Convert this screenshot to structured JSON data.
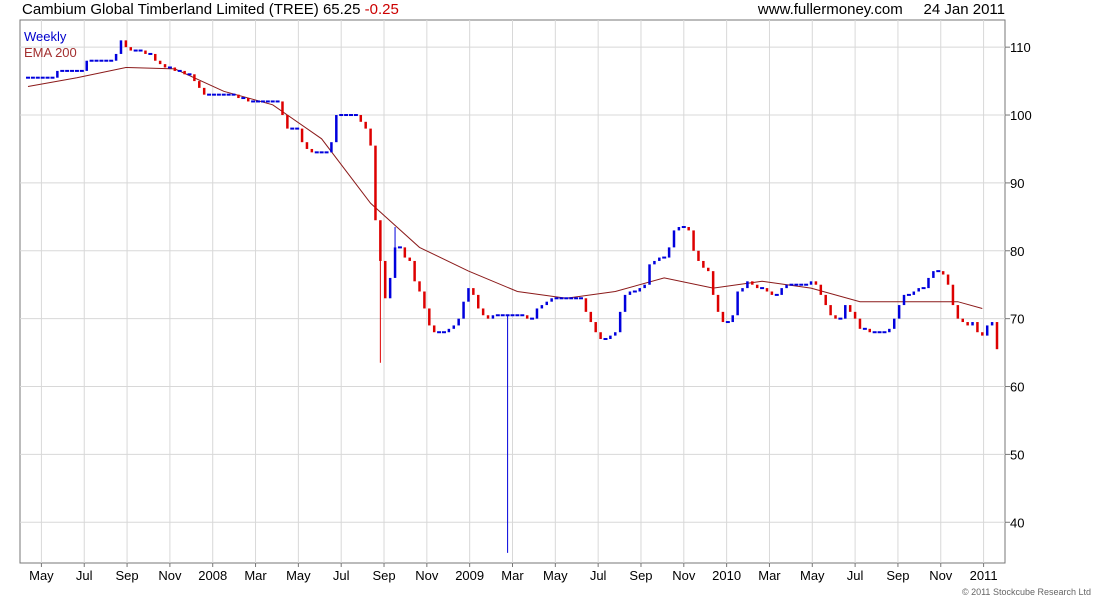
{
  "header": {
    "company": "Cambium Global Timberland Limited (TREE)",
    "last_price": "65.25",
    "change": "-0.25",
    "source_site": "www.fullermoney.com",
    "date": "24 Jan 2011"
  },
  "footer": {
    "copyright": "© 2011 Stockcube Research Ltd"
  },
  "colors": {
    "up": "#0000dd",
    "down": "#dd0000",
    "ema": "#8b1a1a",
    "grid": "#d8d8d8"
  },
  "chart_data": {
    "type": "line",
    "title": "Cambium Global Timberland Limited (TREE)",
    "timeframe": "Weekly",
    "ylim": [
      34,
      114
    ],
    "yticks": [
      40,
      50,
      60,
      70,
      80,
      90,
      100,
      110
    ],
    "x_labels": [
      "May",
      "Jul",
      "Sep",
      "Nov",
      "2008",
      "Mar",
      "May",
      "Jul",
      "Sep",
      "Nov",
      "2009",
      "Mar",
      "May",
      "Jul",
      "Sep",
      "Nov",
      "2010",
      "Mar",
      "May",
      "Jul",
      "Sep",
      "Nov",
      "2011"
    ],
    "legend": [
      "Weekly",
      "EMA 200"
    ],
    "legend_position": "top-left",
    "grid": true,
    "series": [
      {
        "name": "Weekly",
        "kind": "ohlc-bars",
        "x": [
          0,
          1,
          2,
          3,
          4,
          5,
          6,
          7,
          8,
          9,
          10,
          11,
          12,
          13,
          14,
          15,
          16,
          17,
          18,
          19,
          20,
          21,
          22,
          23,
          24,
          25,
          26,
          27,
          28,
          29,
          30,
          31,
          32,
          33,
          34,
          35,
          36,
          37,
          38,
          39,
          40,
          41,
          42,
          43,
          44,
          45,
          46,
          47,
          48,
          49,
          50,
          51,
          52,
          53,
          54,
          55,
          56,
          57,
          58,
          59,
          60,
          61,
          62,
          63,
          64,
          65,
          66,
          67,
          68,
          69,
          70,
          71,
          72,
          73,
          74,
          75,
          76,
          77,
          78,
          79,
          80,
          81,
          82,
          83,
          84,
          85,
          86,
          87,
          88,
          89,
          90,
          91,
          92,
          93,
          94,
          95,
          96,
          97,
          98,
          99,
          100,
          101,
          102,
          103,
          104,
          105,
          106,
          107,
          108,
          109,
          110,
          111,
          112,
          113,
          114,
          115,
          116,
          117,
          118,
          119,
          120,
          121,
          122,
          123,
          124,
          125,
          126,
          127,
          128,
          129,
          130,
          131,
          132,
          133,
          134,
          135,
          136,
          137,
          138,
          139,
          140,
          141,
          142,
          143,
          144,
          145,
          146,
          147,
          148,
          149,
          150,
          151,
          152,
          153,
          154,
          155,
          156,
          157,
          158,
          159,
          160,
          161,
          162,
          163,
          164,
          165,
          166,
          167,
          168,
          169,
          170,
          171,
          172,
          173,
          174,
          175,
          176,
          177,
          178,
          179,
          180,
          181,
          182,
          183,
          184,
          185,
          186,
          187,
          188,
          189,
          190,
          191,
          192,
          193,
          194,
          195
        ],
        "close": [
          105.5,
          105.5,
          105.5,
          105.5,
          105.5,
          105.5,
          106.5,
          106.5,
          106.5,
          106.5,
          106.5,
          106.5,
          108,
          108,
          108,
          108,
          108,
          108,
          109,
          111,
          110,
          109.5,
          109.5,
          109.5,
          109,
          109,
          108,
          107.5,
          107,
          107,
          106.5,
          106.5,
          106,
          106,
          105,
          104,
          103,
          103,
          103,
          103,
          103,
          103,
          103,
          102.5,
          102.5,
          102,
          102,
          102,
          102,
          102,
          102,
          102,
          100,
          98,
          98,
          98,
          96,
          95,
          94.5,
          94.5,
          94.5,
          94.5,
          96,
          100,
          100,
          100,
          100,
          100,
          99,
          98,
          95.5,
          84.5,
          78.5,
          73,
          76,
          80.5,
          80.5,
          79,
          78.5,
          75.5,
          74,
          71.5,
          69,
          68,
          68,
          68,
          68.5,
          69,
          70,
          72.5,
          74.5,
          73.5,
          71.5,
          70.5,
          70,
          70.5,
          70.5,
          70.5,
          70.5,
          70.5,
          70.5,
          70.5,
          70,
          70,
          71.5,
          72,
          72.5,
          73,
          73,
          73,
          73,
          73,
          73,
          73,
          71,
          69.5,
          68,
          67,
          67,
          67.5,
          68,
          71,
          73.5,
          74,
          74,
          74.5,
          75,
          78,
          78.5,
          79,
          79,
          80.5,
          83,
          83.5,
          83.5,
          83,
          80,
          78.5,
          77.5,
          77,
          73.5,
          71,
          69.5,
          69.5,
          70.5,
          74,
          74.5,
          75.5,
          75,
          74.5,
          74.5,
          74,
          73.5,
          73.5,
          74.5,
          75,
          75,
          75,
          75,
          75,
          75.5,
          75,
          73.5,
          72,
          70.5,
          70,
          70,
          72,
          71,
          70,
          68.5,
          68.5,
          68,
          68,
          68,
          68,
          68.5,
          70,
          72,
          73.5,
          73.5,
          74,
          74.5,
          74.5,
          76,
          77,
          77,
          76.5,
          75,
          72,
          70,
          69.5,
          69,
          69.5,
          68,
          67.5,
          69,
          69.5,
          65.5
        ]
      },
      {
        "name": "EMA 200",
        "kind": "line",
        "x": [
          0,
          10,
          20,
          30,
          40,
          50,
          60,
          70,
          80,
          90,
          100,
          110,
          120,
          130,
          140,
          150,
          160,
          170,
          180,
          190,
          195
        ],
        "y": [
          104.2,
          105.5,
          107,
          106.8,
          103.5,
          101.5,
          96.5,
          87,
          80.5,
          77,
          74,
          73,
          74,
          76,
          74.5,
          75.5,
          74.5,
          72.5,
          72.5,
          72.5,
          71.5
        ]
      }
    ]
  }
}
